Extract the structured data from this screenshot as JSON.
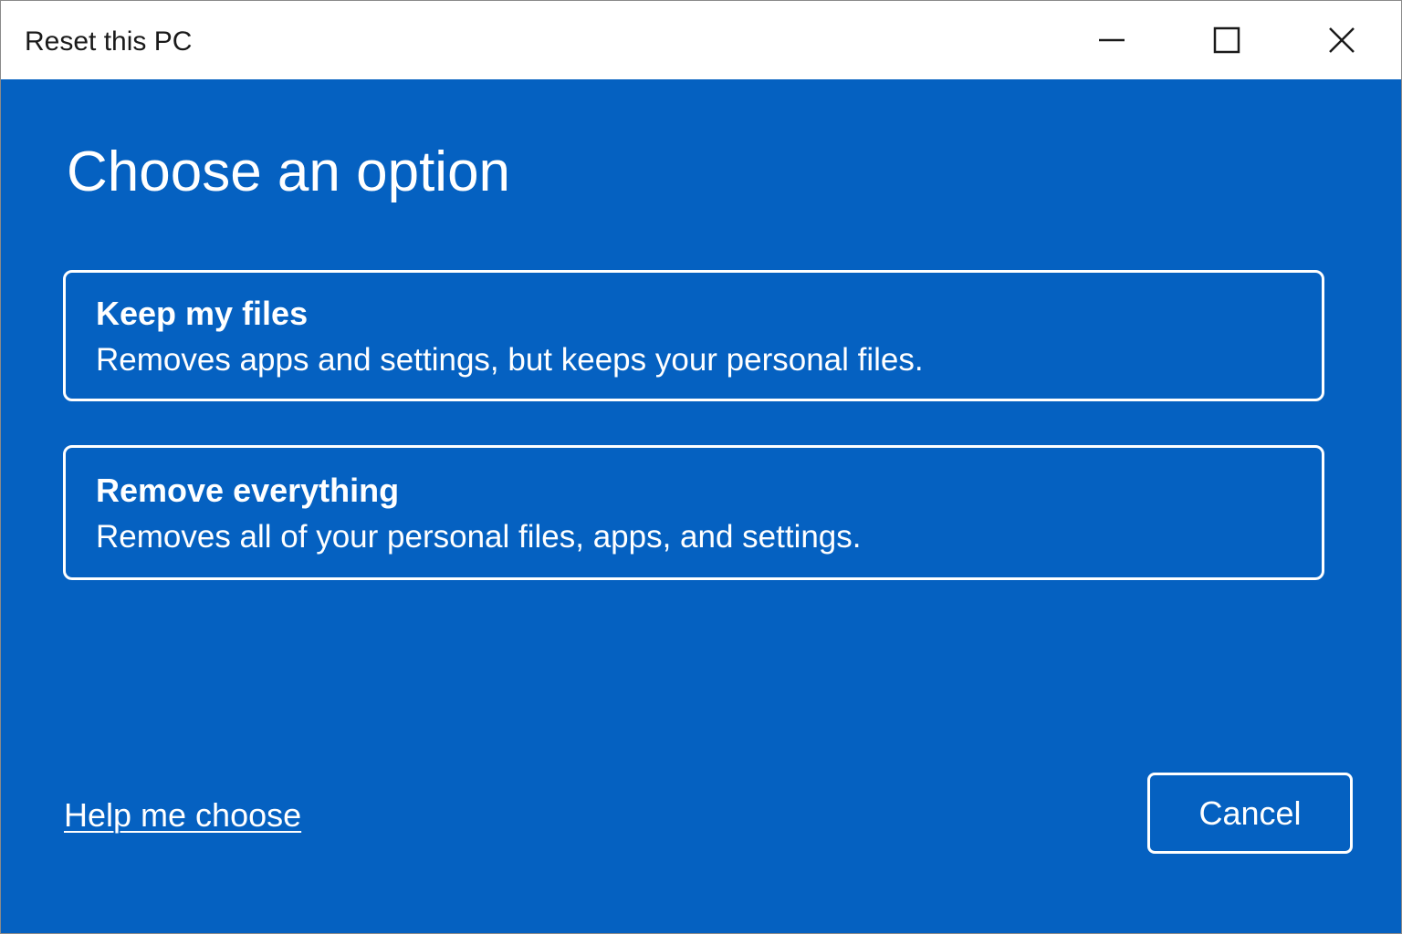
{
  "window": {
    "title": "Reset this PC",
    "controls": {
      "minimize_icon": "minimize-icon",
      "maximize_icon": "maximize-icon",
      "close_icon": "close-icon"
    }
  },
  "main": {
    "heading": "Choose an option",
    "options": [
      {
        "title": "Keep my files",
        "description": "Removes apps and settings, but keeps your personal files."
      },
      {
        "title": "Remove everything",
        "description": "Removes all of your personal files, apps, and settings."
      }
    ],
    "help_link": "Help me choose",
    "cancel_label": "Cancel"
  },
  "colors": {
    "background": "#0561c1",
    "titlebar": "#ffffff",
    "text_on_blue": "#ffffff"
  }
}
